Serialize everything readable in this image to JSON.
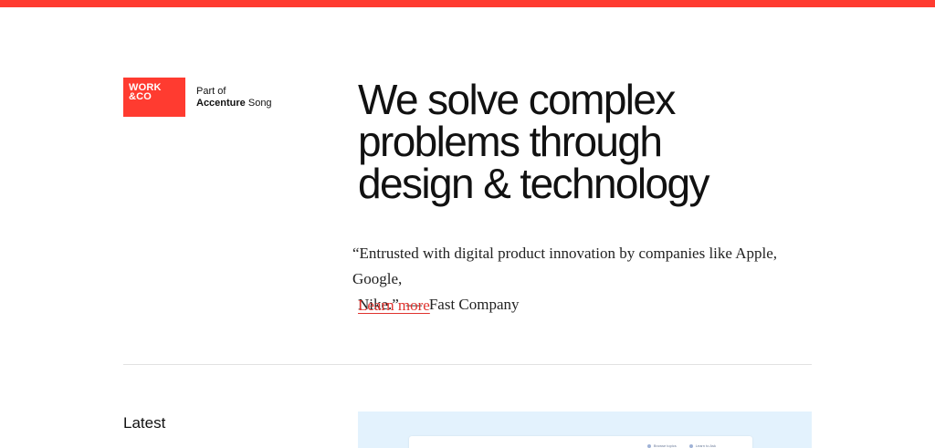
{
  "colors": {
    "accent": "#ff3b30",
    "link": "#e0332e",
    "card_bg": "#e3f2fd",
    "divider": "#e2e2e2"
  },
  "logo": {
    "line1": "WORK",
    "line2": "&CO"
  },
  "parent": {
    "prefix": "Part of",
    "brand": "Accenture",
    "suffix": "Song"
  },
  "hero": {
    "headline_lines": [
      "We solve complex",
      "problems through",
      "design & technology"
    ],
    "quote_line1": "“Entrusted with digital product innovation by companies like Apple, Google,",
    "quote_line2": "Nike.”",
    "quote_dash": "—",
    "quote_source": "Fast Company",
    "cta": "Learn more"
  },
  "latest": {
    "title": "Latest",
    "card": {
      "nav": [
        "Browse topics",
        "Learn to Ask"
      ]
    }
  }
}
